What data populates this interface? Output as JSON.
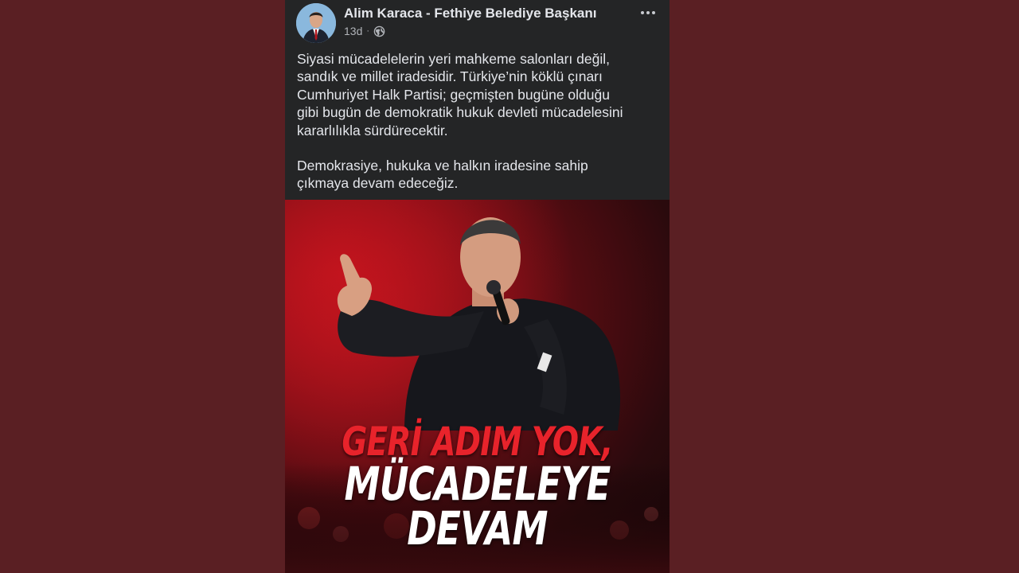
{
  "post": {
    "author": "Alim Karaca - Fethiye Belediye Başkanı",
    "time": "13d",
    "separator": "·",
    "privacy_icon": "globe-icon",
    "more_icon": "more-options-icon",
    "paragraphs": [
      "Siyasi mücadelelerin yeri mahkeme salonları değil,\nsandık ve millet iradesidir. Türkiye’nin köklü çınarı\nCumhuriyet Halk Partisi; geçmişten bugüne olduğu\ngibi bugün de demokratik hukuk devleti mücadelesini\nkararlılıkla sürdürecektir.",
      "Demokrasiye, hukuka ve halkın iradesine sahip\nçıkmaya devam edeceğiz."
    ]
  },
  "image": {
    "line1": "GERİ ADIM YOK,",
    "line2": "MÜCADELEYE",
    "line3": "DEVAM"
  },
  "colors": {
    "page_background": "#5a1f23",
    "post_background": "#242526",
    "text_primary": "#e4e6eb",
    "text_secondary": "#b0b3b8",
    "headline_red": "#e8232b",
    "headline_white": "#ffffff"
  }
}
